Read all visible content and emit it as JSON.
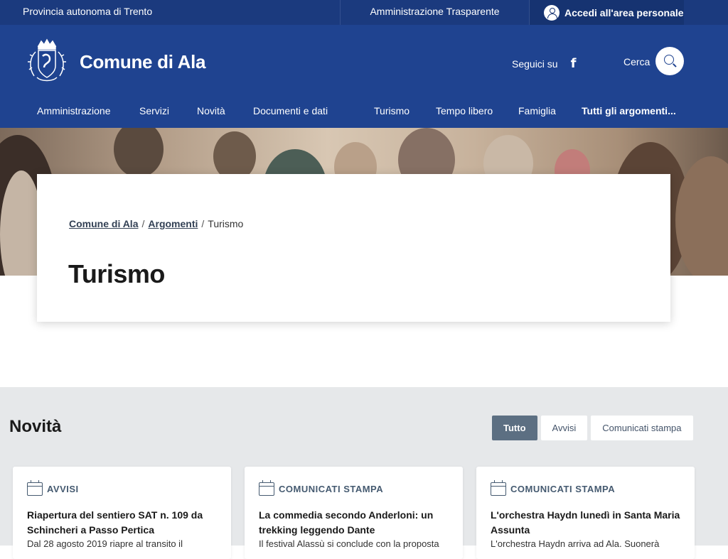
{
  "topbar": {
    "region": "Provincia autonoma di Trento",
    "transparency": "Amministrazione Trasparente",
    "login": "Accedi all'area personale"
  },
  "header": {
    "title": "Comune di Ala",
    "follow_label": "Seguici su",
    "social_icon": "f",
    "search_label": "Cerca"
  },
  "nav": [
    "Amministrazione",
    "Servizi",
    "Novità",
    "Documenti e dati",
    "Turismo",
    "Tempo libero",
    "Famiglia",
    "Tutti gli argomenti..."
  ],
  "breadcrumb": {
    "items": [
      "Comune di Ala",
      "Argomenti",
      "Turismo"
    ],
    "separator": "/"
  },
  "page_title": "Turismo",
  "news": {
    "title": "Novità",
    "filters": [
      "Tutto",
      "Avvisi",
      "Comunicati stampa"
    ],
    "active_filter": "Tutto",
    "cards": [
      {
        "category": "AVVISI",
        "title": "Riapertura del sentiero SAT n. 109 da Schincheri a Passo Pertica",
        "excerpt": "Dal 28 agosto 2019 riapre al transito il"
      },
      {
        "category": "COMUNICATI STAMPA",
        "title": "La commedia secondo Anderloni: un trekking leggendo Dante",
        "excerpt": "Il festival Alassù si conclude con la proposta"
      },
      {
        "category": "COMUNICATI STAMPA",
        "title": "L'orchestra Haydn lunedì in Santa Maria Assunta",
        "excerpt": "L'orchestra Haydn arriva ad Ala. Suonerà"
      }
    ]
  },
  "colors": {
    "header_blue": "#1f4390",
    "topbar_blue": "#1b3a7e",
    "filter_active": "#5c6f82",
    "news_bg": "#e6e8ea"
  }
}
